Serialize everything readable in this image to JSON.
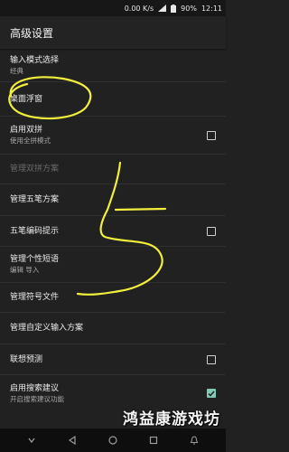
{
  "status_bar": {
    "speed": "0.00 K/s",
    "battery": "90%",
    "time": "12:11"
  },
  "app_bar": {
    "title": "高级设置"
  },
  "settings": [
    {
      "title": "输入模式选择",
      "summary": "经典"
    },
    {
      "title": "桌面浮窗"
    },
    {
      "title": "启用双拼",
      "summary": "使用全拼模式",
      "checkbox": false
    },
    {
      "title": "管理双拼方案",
      "disabled": true
    },
    {
      "title": "管理五笔方案"
    },
    {
      "title": "五笔编码提示",
      "checkbox": false
    },
    {
      "title": "管理个性短语",
      "summary": "编辑    导入"
    },
    {
      "title": "管理符号文件"
    },
    {
      "title": "管理自定义输入方案"
    },
    {
      "title": "联想预测",
      "checkbox": false
    },
    {
      "title": "启用搜索建议",
      "summary": "开启搜索建议功能",
      "checkbox": true
    }
  ],
  "watermark": "鸿益康游戏坊",
  "colors": {
    "background": "#212121",
    "checkbox_checked": "#7fcbb5",
    "annotation": "#f2ef3c"
  },
  "icons": [
    "signal-icon",
    "battery-icon",
    "back-icon",
    "home-icon",
    "recents-icon",
    "notification-icon"
  ]
}
